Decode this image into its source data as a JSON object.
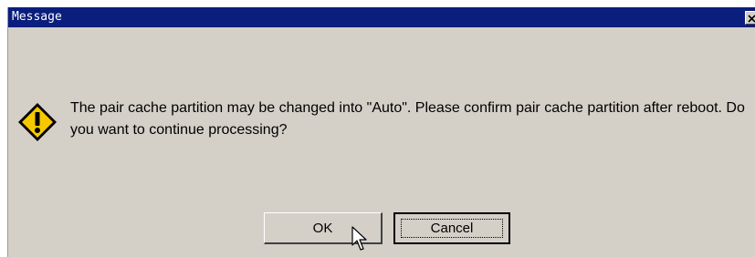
{
  "dialog": {
    "title": "Message",
    "close_icon": "close-x-icon",
    "icon": "warning-exclamation-icon",
    "message": "The pair cache partition may be changed into \"Auto\". Please confirm pair cache partition after reboot. Do you want to continue processing?",
    "ok_label": "OK",
    "cancel_label": "Cancel",
    "focused_button": "Cancel"
  },
  "colors": {
    "titlebar": "#0a1e7d",
    "dialog_bg": "#d4d0c8",
    "warning_fill": "#f6c800"
  }
}
